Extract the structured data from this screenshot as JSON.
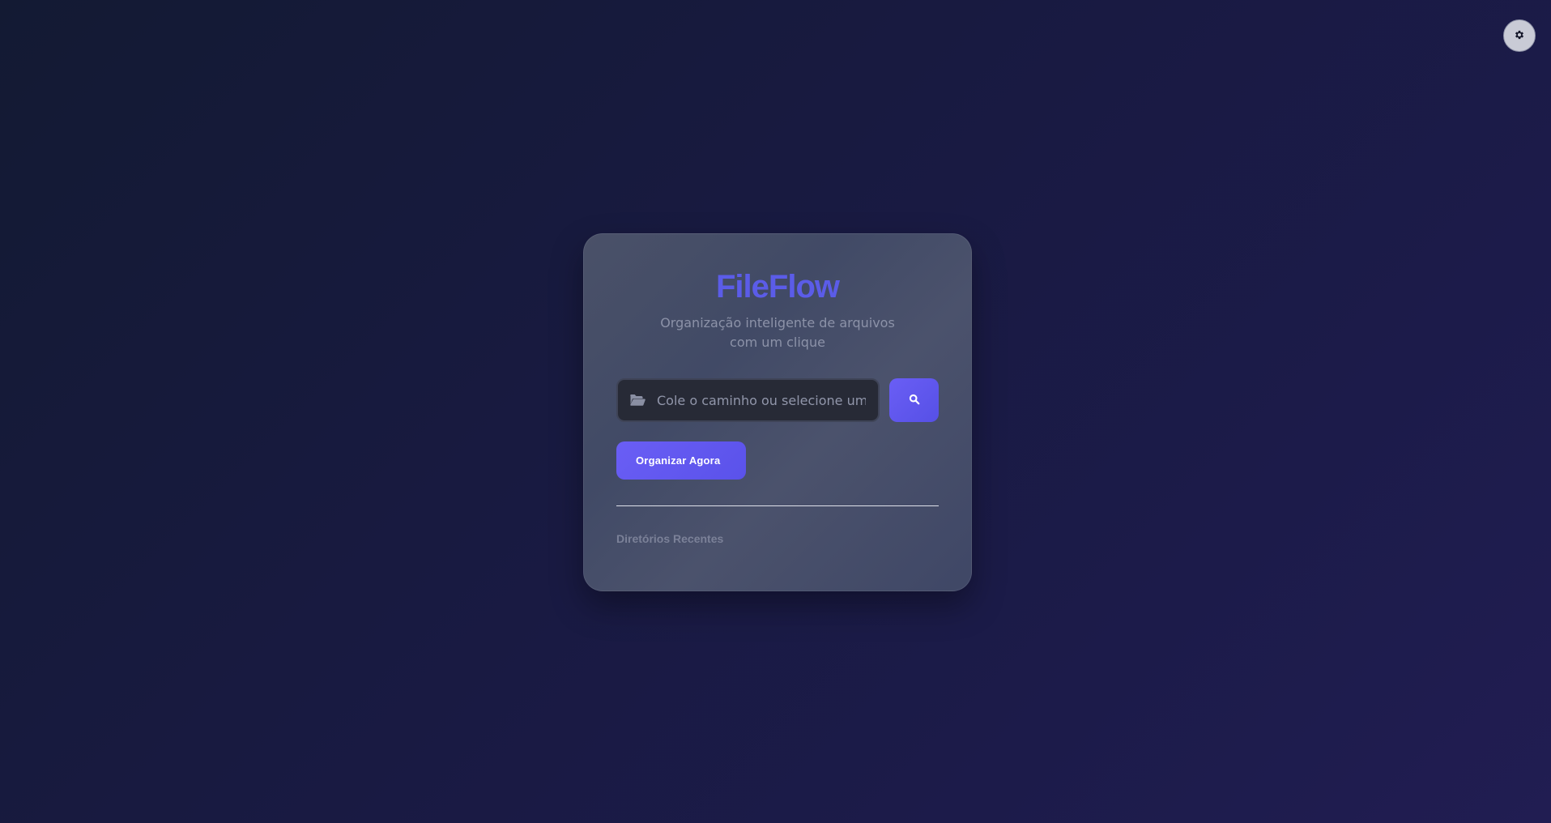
{
  "theme_toggle": {
    "icon": "gear-icon"
  },
  "card": {
    "brand": "FileFlow",
    "subtitle": "Organização inteligente de arquivos com um clique",
    "path_input": {
      "value": "",
      "placeholder": "Cole o caminho ou selecione um diretório",
      "icon": "folder-open-icon"
    },
    "browse_button": {
      "icon": "search-icon"
    },
    "organize_button": {
      "label": "Organizar Agora"
    },
    "recent_title": "Diretórios Recentes"
  },
  "colors": {
    "accent": "#5b5ce8",
    "button_start": "#6a5ef5",
    "button_end": "#5650e6",
    "card_bg": "#464d68",
    "background": "#181a40"
  }
}
